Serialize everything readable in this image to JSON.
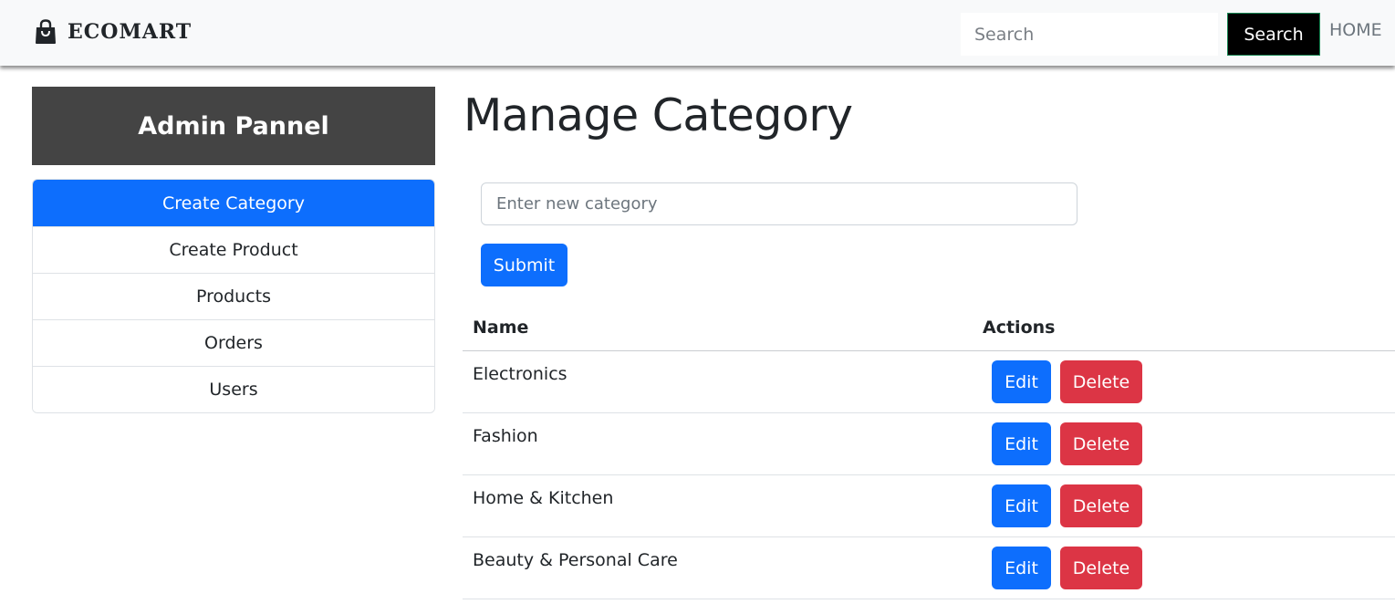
{
  "navbar": {
    "brand": "ECOMART",
    "brand_icon": "shopping-bag-icon",
    "search_placeholder": "Search",
    "search_button": "Search",
    "home_link": "HOME"
  },
  "sidebar": {
    "title": "Admin Pannel",
    "items": [
      {
        "label": "Create Category",
        "active": true
      },
      {
        "label": "Create Product",
        "active": false
      },
      {
        "label": "Products",
        "active": false
      },
      {
        "label": "Orders",
        "active": false
      },
      {
        "label": "Users",
        "active": false
      }
    ]
  },
  "main": {
    "title": "Manage Category",
    "category_input_placeholder": "Enter new category",
    "submit_label": "Submit",
    "table": {
      "headers": [
        "Name",
        "Actions"
      ],
      "edit_label": "Edit",
      "delete_label": "Delete",
      "rows": [
        {
          "name": "Electronics"
        },
        {
          "name": "Fashion"
        },
        {
          "name": "Home & Kitchen"
        },
        {
          "name": "Beauty & Personal Care"
        }
      ]
    }
  },
  "colors": {
    "primary": "#0d6efd",
    "danger": "#dc3545",
    "sidebar_header": "#444444",
    "navbar_bg": "#f8f9fa"
  }
}
